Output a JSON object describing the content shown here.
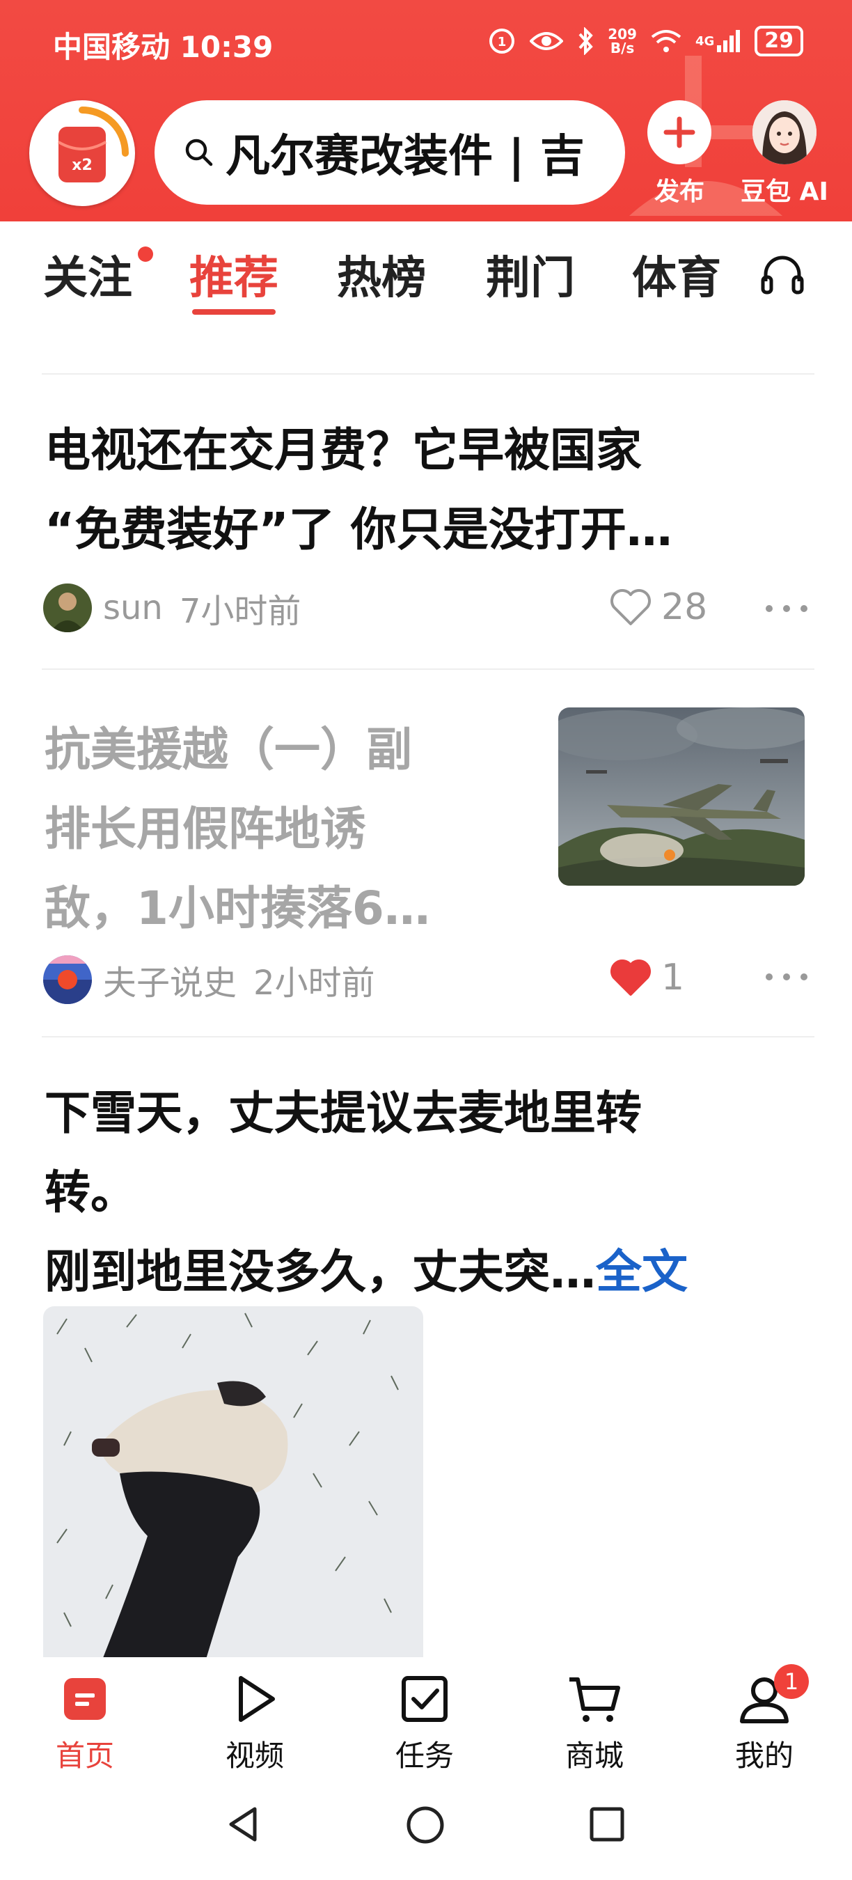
{
  "status_bar": {
    "carrier_time": "中国移动 10:39",
    "net_speed_value": "209",
    "net_speed_unit": "B/s",
    "signal_label": "4G",
    "battery": "29"
  },
  "header": {
    "search_text": "凡尔赛改装件 | 吉",
    "publish_label": "发布",
    "ai_label": "豆包 AI",
    "logo_text": "x2"
  },
  "tabs": [
    {
      "label": "关注"
    },
    {
      "label": "推荐"
    },
    {
      "label": "热榜"
    },
    {
      "label": "荆门"
    },
    {
      "label": "体育"
    }
  ],
  "feed": {
    "items": [
      {
        "title_line1": "电视还在交月费？它早被国家",
        "title_line2": "“免费装好”了 你只是没打开…",
        "author": "sun",
        "time": "7小时前",
        "likes": "28",
        "liked": false
      },
      {
        "title_line1": "抗美援越（一）副",
        "title_line2": "排长用假阵地诱",
        "title_line3": "敌，1小时揍落6…",
        "author": "夫子说史",
        "time": "2小时前",
        "likes": "1",
        "liked": true,
        "thumbnail": "fighter-jet-image"
      },
      {
        "title_line1": "下雪天，丈夫提议去麦地里转",
        "title_line2": "转。",
        "title_line3": "刚到地里没多久，丈夫突…",
        "full_text_label": "全文",
        "image": "person-lying-in-snow-image"
      }
    ]
  },
  "bottom_nav": {
    "items": [
      {
        "label": "首页"
      },
      {
        "label": "视频"
      },
      {
        "label": "任务"
      },
      {
        "label": "商城"
      },
      {
        "label": "我的",
        "badge": "1"
      }
    ]
  },
  "colors": {
    "brand_red": "#f0413a",
    "link_blue": "#1a62c9",
    "muted_gray": "#999999"
  }
}
